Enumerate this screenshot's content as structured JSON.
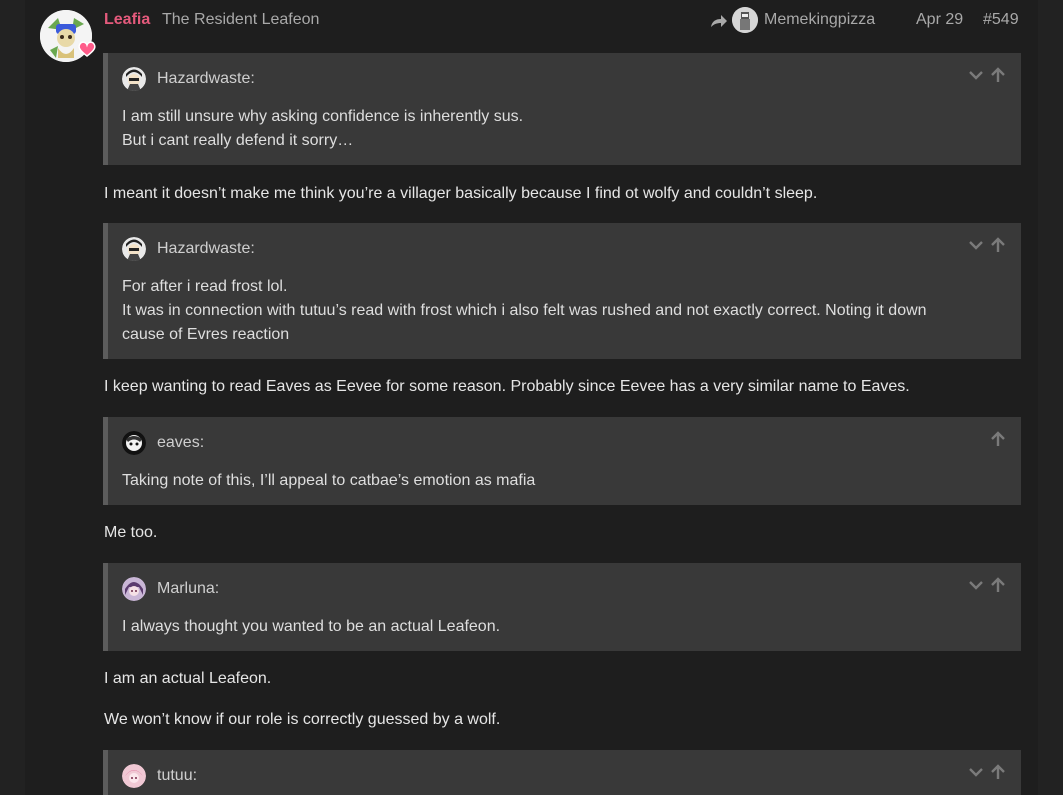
{
  "post": {
    "author": "Leafia",
    "author_title": "The Resident Leafeon",
    "reply_to": "Memekingpizza",
    "date": "Apr 29",
    "number": "#549"
  },
  "quotes": [
    {
      "author": "Hazardwaste:",
      "lines": [
        "I am still unsure why asking confidence is inherently sus.",
        "But i cant really defend it sorry…"
      ]
    },
    {
      "author": "Hazardwaste:",
      "lines": [
        "For after i read frost lol.",
        "It was in connection with tutuu’s read with frost which i also felt was rushed and not exactly correct. Noting it down",
        "cause of Evres reaction"
      ]
    },
    {
      "author": "eaves:",
      "lines": [
        "Taking note of this, I’ll appeal to catbae’s emotion as mafia"
      ]
    },
    {
      "author": "Marluna:",
      "lines": [
        "I always thought you wanted to be an actual Leafeon."
      ]
    },
    {
      "author": "tutuu:",
      "lines": []
    }
  ],
  "paragraphs": [
    "I meant it doesn’t make me think you’re a villager basically because I find ot wolfy and couldn’t sleep.",
    "I keep wanting to read Eaves as Eevee for some reason. Probably since Eevee has a very similar name to Eaves.",
    "Me too.",
    "I am an actual Leafeon.",
    "We won’t know if our role is correctly guessed by a wolf."
  ],
  "icons": {
    "reply": "share-arrow-icon",
    "expand": "chevron-down-icon",
    "jump": "arrow-up-icon",
    "heart": "heart-icon"
  },
  "colors": {
    "background": "#222222",
    "quote_bg": "#393939",
    "username": "#e45a7c",
    "muted": "#a9a9a9"
  }
}
